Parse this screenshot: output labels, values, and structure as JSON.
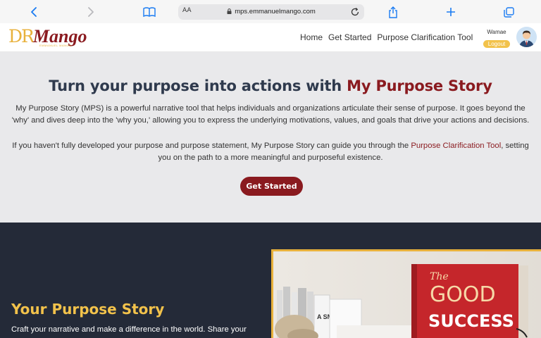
{
  "browser": {
    "url": "mps.emmanuelmango.com",
    "text_size_label": "AA",
    "icons": [
      "back-icon",
      "forward-icon",
      "bookmarks-icon",
      "lock-icon",
      "reload-icon",
      "share-icon",
      "new-tab-icon",
      "tabs-icon"
    ]
  },
  "nav": {
    "logo_dr": "DR",
    "logo_mango": "Mango",
    "logo_tagline": "EMMANUEL MANGO",
    "links": [
      "Home",
      "Get Started",
      "Purpose Clarification Tool"
    ],
    "user_name": "Wamae",
    "logout_label": "Logout"
  },
  "hero": {
    "title_prefix": "Turn your purpose into actions with ",
    "title_accent": "My Purpose Story",
    "paragraph1": "My Purpose Story (MPS) is a powerful narrative tool that helps individuals and organizations articulate their sense of purpose. It goes beyond the 'why' and dives deep into the 'why you,' allowing you to express the underlying motivations, values, and goals that drive your actions and decisions.",
    "paragraph2_before": "If you haven't fully developed your purpose and purpose statement, My Purpose Story can guide you through the ",
    "paragraph2_link": "Purpose Clarification Tool",
    "paragraph2_after": ", setting you on the path to a more meaningful and purposeful existence.",
    "cta_label": "Get Started"
  },
  "section": {
    "title": "Your Purpose Story",
    "text": "Craft your narrative and make a difference in the world. Share your",
    "book_title_the": "The",
    "book_title_good": "GOOD",
    "book_title_success": "SUCCESS",
    "side_book_text": "A SMILE"
  },
  "colors": {
    "brand_red": "#8a1a1f",
    "brand_gold": "#e8b13c",
    "title_navy": "#2f3a4d",
    "dark_bg": "#242a38",
    "hero_bg": "#e9e9eb"
  }
}
